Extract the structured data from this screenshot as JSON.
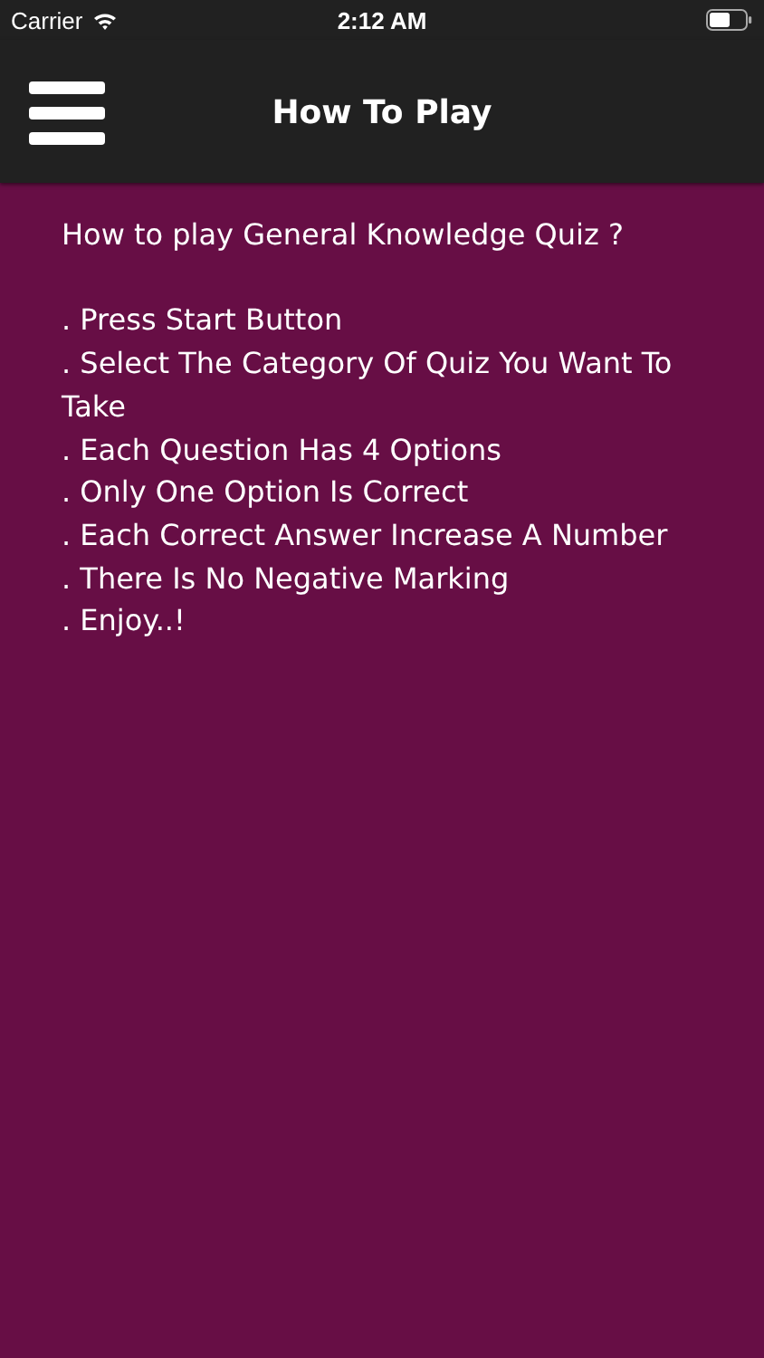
{
  "status_bar": {
    "carrier": "Carrier",
    "time": "2:12 AM"
  },
  "nav_bar": {
    "title": "How To Play"
  },
  "content": {
    "heading": "How to play General Knowledge Quiz ?",
    "rules": [
      ". Press Start Button",
      ". Select The Category Of Quiz You Want To Take",
      ". Each Question Has 4 Options",
      ". Only One Option Is Correct",
      ". Each Correct Answer Increase A Number",
      ". There Is No Negative Marking",
      ". Enjoy..!"
    ]
  }
}
